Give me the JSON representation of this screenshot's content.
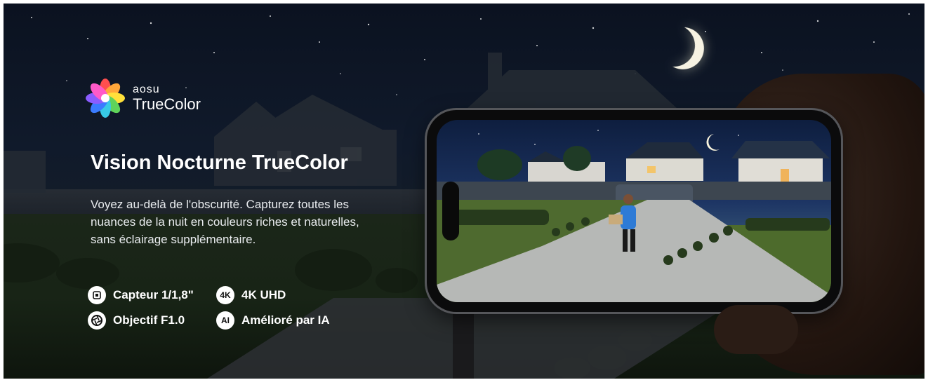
{
  "brand": {
    "name_top": "aosu",
    "name_bottom": "TrueColor"
  },
  "headline": "Vision Nocturne TrueColor",
  "description": "Voyez au-delà de l'obscurité. Capturez toutes les nuances de la nuit en couleurs riches et naturelles, sans éclairage supplémentaire.",
  "features": [
    {
      "icon": "chip-icon",
      "label": "Capteur 1/1,8\""
    },
    {
      "icon": "4k-icon",
      "icon_text": "4K",
      "label": "4K UHD"
    },
    {
      "icon": "aperture-icon",
      "label": "Objectif F1.0"
    },
    {
      "icon": "ai-icon",
      "icon_text": "AI",
      "label": "Amélioré par IA"
    }
  ],
  "colors": {
    "text": "#ffffff",
    "night_sky": "#0b1220",
    "moon": "#f6f2e2"
  }
}
